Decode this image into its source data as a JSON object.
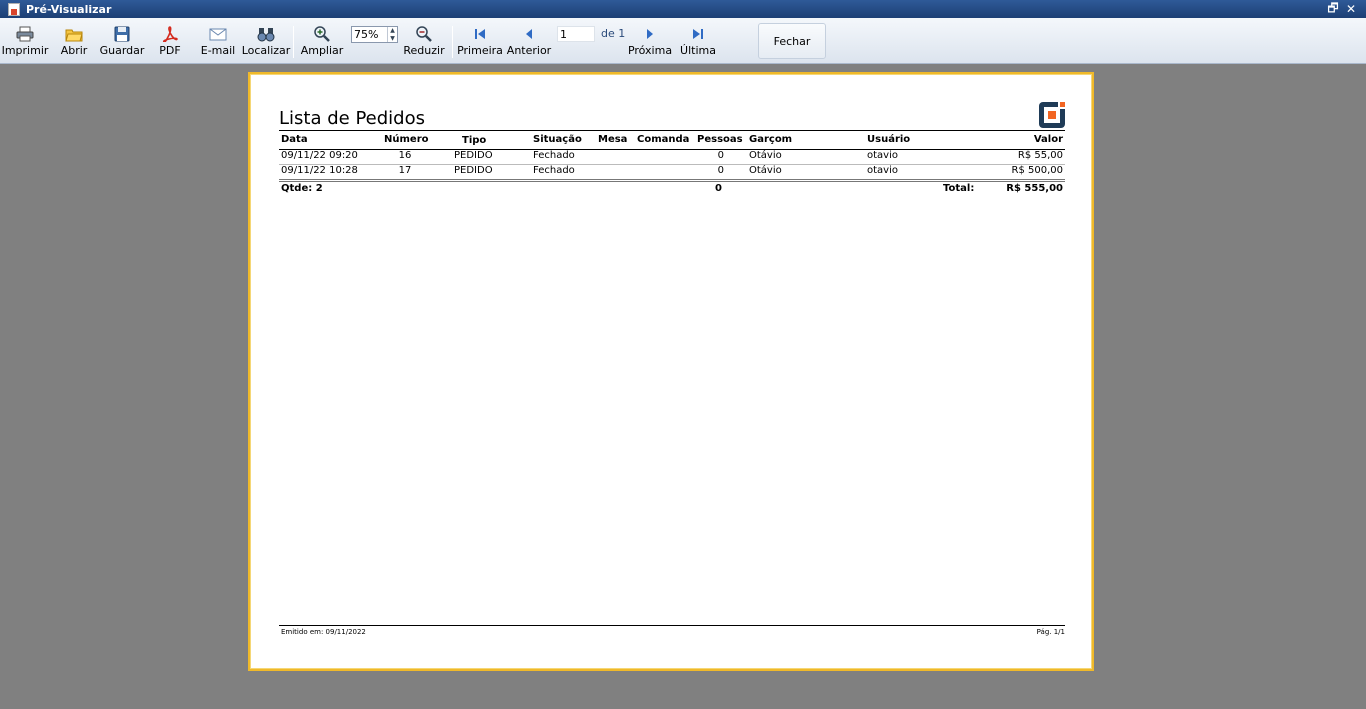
{
  "window": {
    "title": "Pré-Visualizar"
  },
  "toolbar": {
    "print": "Imprimir",
    "open": "Abrir",
    "save": "Guardar",
    "pdf": "PDF",
    "email": "E-mail",
    "find": "Localizar",
    "zoom_in": "Ampliar",
    "zoom_value": "75%",
    "zoom_out": "Reduzir",
    "first": "Primeira",
    "previous": "Anterior",
    "page_value": "1",
    "page_of": "de 1",
    "next": "Próxima",
    "last": "Última",
    "close": "Fechar"
  },
  "report": {
    "title": "Lista de Pedidos",
    "columns": {
      "data": "Data",
      "numero": "Número",
      "tipo": "Tipo",
      "situacao": "Situação",
      "mesa": "Mesa",
      "comanda": "Comanda",
      "pessoas": "Pessoas",
      "garcom": "Garçom",
      "usuario": "Usuário",
      "valor": "Valor"
    },
    "rows": [
      {
        "data": "09/11/22 09:20",
        "numero": "16",
        "tipo": "PEDIDO",
        "situacao": "Fechado",
        "mesa": "",
        "comanda": "",
        "pessoas": "0",
        "garcom": "Otávio",
        "usuario": "otavio",
        "valor": "R$ 55,00"
      },
      {
        "data": "09/11/22 10:28",
        "numero": "17",
        "tipo": "PEDIDO",
        "situacao": "Fechado",
        "mesa": "",
        "comanda": "",
        "pessoas": "0",
        "garcom": "Otávio",
        "usuario": "otavio",
        "valor": "R$ 500,00"
      }
    ],
    "summary": {
      "count_label": "Qtde: 2",
      "pessoas_total": "0",
      "total_label": "Total:",
      "total_value": "R$ 555,00"
    },
    "footer": {
      "emitted": "Emitido em: 09/11/2022",
      "page": "Pág. 1/1"
    }
  },
  "colors": {
    "titlebar": "#1d3f74",
    "page_border": "#f0b92a",
    "logo_dark": "#1f3b57",
    "logo_accent": "#f26522"
  }
}
